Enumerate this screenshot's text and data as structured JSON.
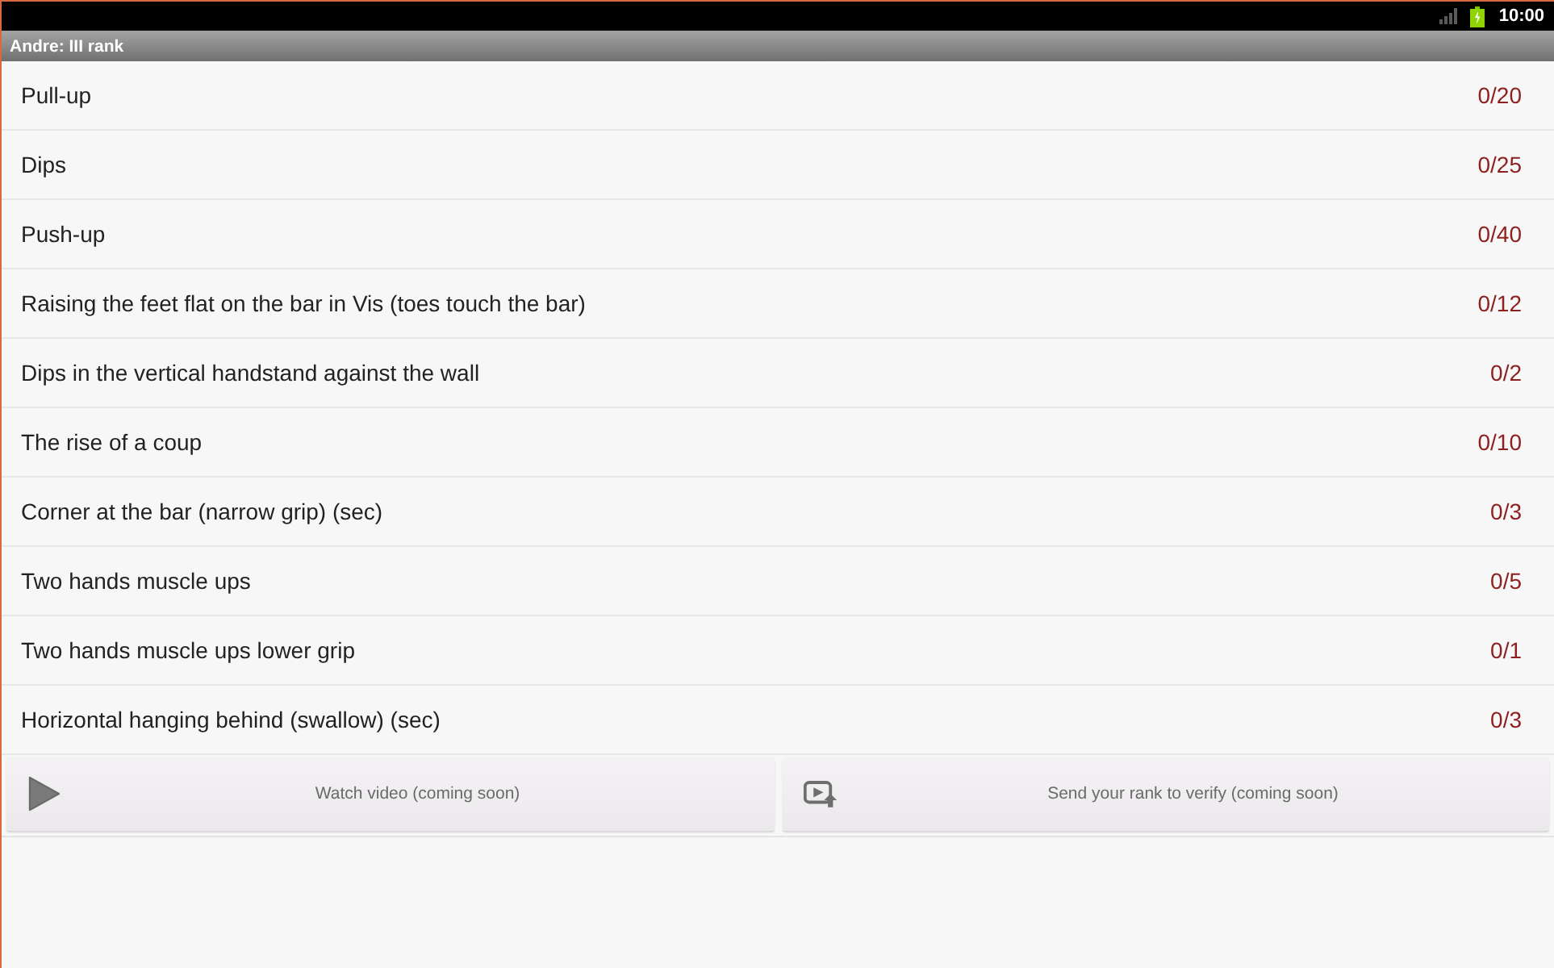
{
  "status_bar": {
    "time": "10:00"
  },
  "title_bar": {
    "title": "Andre: III rank"
  },
  "exercises": [
    {
      "name": "Pull-up",
      "score": "0/20"
    },
    {
      "name": "Dips",
      "score": "0/25"
    },
    {
      "name": "Push-up",
      "score": "0/40"
    },
    {
      "name": "Raising the feet flat on the bar in Vis (toes touch the bar)",
      "score": "0/12"
    },
    {
      "name": "Dips in the vertical handstand against the wall",
      "score": "0/2"
    },
    {
      "name": "The rise of a coup",
      "score": "0/10"
    },
    {
      "name": "Corner at the bar (narrow grip) (sec)",
      "score": "0/3"
    },
    {
      "name": "Two hands muscle ups",
      "score": "0/5"
    },
    {
      "name": "Two hands muscle ups lower grip",
      "score": "0/1"
    },
    {
      "name": "Horizontal hanging behind (swallow) (sec)",
      "score": "0/3"
    }
  ],
  "buttons": [
    {
      "kind": "play",
      "label": "Watch video (coming soon)"
    },
    {
      "kind": "upload",
      "label": "Send your rank to verify (coming soon)"
    }
  ]
}
